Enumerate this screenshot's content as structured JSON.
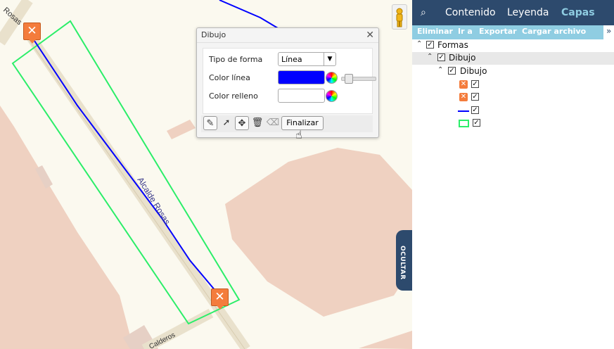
{
  "map": {
    "street_main": "Alcalde Rosas",
    "street_main_top": "Rosas",
    "street_bottom": "Calderos",
    "hide_button": "OCULTAR",
    "markers": [
      "marker-icon",
      "marker-icon"
    ]
  },
  "dialog": {
    "title": "Dibujo",
    "close": "✕",
    "shape_type_label": "Tipo de forma",
    "shape_type_value": "Línea",
    "line_color_label": "Color línea",
    "line_color": "#0000ff",
    "fill_color_label": "Color relleno",
    "fill_color": "#ffffff",
    "finalize": "Finalizar",
    "tools": [
      "pencil-icon",
      "pointer-icon",
      "move-icon",
      "trash-icon",
      "eraser-icon"
    ]
  },
  "sidebar": {
    "tabs": [
      "Contenido",
      "Leyenda",
      "Capas"
    ],
    "active_tab": "Capas",
    "actions": [
      "Eliminar",
      "Ir a",
      "Exportar",
      "Cargar archivo"
    ],
    "more": "»",
    "tree": [
      {
        "label": "Formas",
        "checked": true,
        "level": 0
      },
      {
        "label": "Dibujo",
        "checked": true,
        "level": 1
      },
      {
        "label": "Dibujo",
        "checked": true,
        "level": 2
      }
    ],
    "legend_items": [
      "marker",
      "marker",
      "line",
      "polygon"
    ],
    "colors": {
      "header": "#2d4a6d",
      "actions": "#8fcde2",
      "active_tab": "#8fcde2"
    }
  }
}
